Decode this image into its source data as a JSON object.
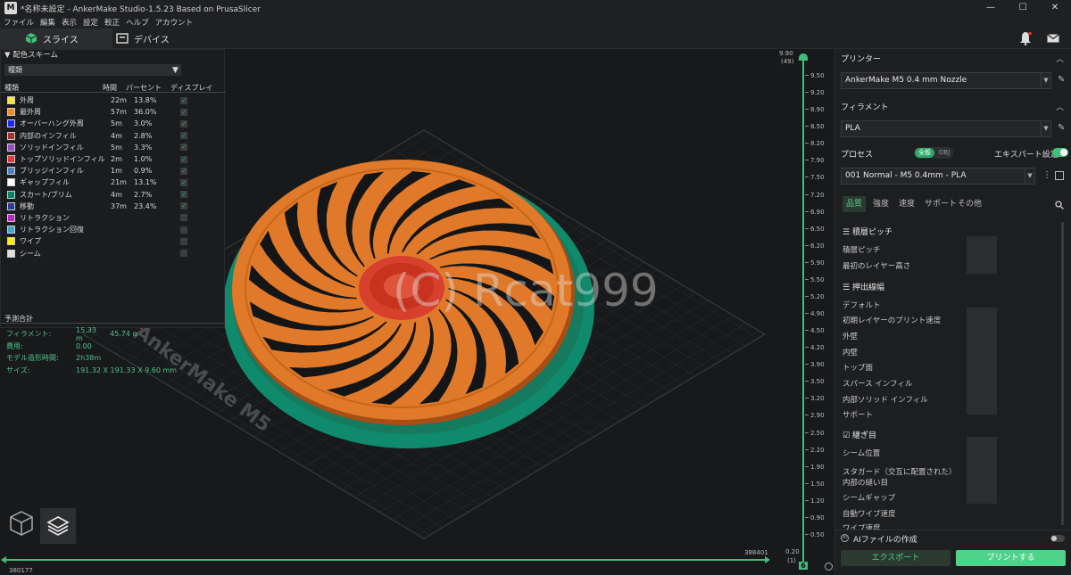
{
  "window": {
    "title": "*名称未設定 - AnkerMake Studio-1.5.23 Based on PrusaSlicer",
    "logo": "M",
    "controls": [
      "—",
      "☐",
      "✕"
    ]
  },
  "menu": [
    "ファイル",
    "編集",
    "表示",
    "設定",
    "較正",
    "ヘルプ",
    "アカウント"
  ],
  "tabs": [
    {
      "label": "スライス",
      "icon": "cube-icon"
    },
    {
      "label": "デバイス",
      "icon": "device-icon"
    }
  ],
  "legend": {
    "title": "配色スキーム",
    "scheme": "種類",
    "columns": [
      "種類",
      "時間",
      "パーセント",
      "ディスプレイ"
    ],
    "rows": [
      {
        "name": "外周",
        "time": "22m",
        "pct": "13.8%",
        "color": "#f5e642",
        "shown": true
      },
      {
        "name": "最外周",
        "time": "57m",
        "pct": "36.0%",
        "color": "#f58a1f",
        "shown": true
      },
      {
        "name": "オーバーハング外周",
        "time": "5m",
        "pct": "3.0%",
        "color": "#2424ff",
        "shown": true
      },
      {
        "name": "内部のインフィル",
        "time": "4m",
        "pct": "2.8%",
        "color": "#b0302f",
        "shown": true
      },
      {
        "name": "ソリッドインフィル",
        "time": "5m",
        "pct": "3.3%",
        "color": "#9a4fc0",
        "shown": true
      },
      {
        "name": "トップソリッドインフィル",
        "time": "2m",
        "pct": "1.0%",
        "color": "#e03a3a",
        "shown": true
      },
      {
        "name": "ブリッジインフィル",
        "time": "1m",
        "pct": "0.9%",
        "color": "#4f7fbf",
        "shown": true
      },
      {
        "name": "ギャップフィル",
        "time": "21m",
        "pct": "13.1%",
        "color": "#ffffff",
        "shown": true
      },
      {
        "name": "スカート/ブリム",
        "time": "4m",
        "pct": "2.7%",
        "color": "#00876a",
        "shown": true
      },
      {
        "name": "移動",
        "time": "37m",
        "pct": "23.4%",
        "color": "#2c3c9a",
        "shown": true
      },
      {
        "name": "リトラクション",
        "time": "",
        "pct": "",
        "color": "#c027c0",
        "shown": false
      },
      {
        "name": "リトラクション回復",
        "time": "",
        "pct": "",
        "color": "#3fa8c8",
        "shown": false
      },
      {
        "name": "ワイプ",
        "time": "",
        "pct": "",
        "color": "#ffee00",
        "shown": false
      },
      {
        "name": "シーム",
        "time": "",
        "pct": "",
        "color": "#e0e0e0",
        "shown": false
      }
    ]
  },
  "estimate": {
    "title": "予測合計",
    "filament_label": "フィラメント:",
    "filament_len": "15.33 m",
    "filament_weight": "45.74 g",
    "cost_label": "費用:",
    "cost": "0.00",
    "time_label": "モデル造形時間:",
    "time": "2h38m",
    "size_label": "サイズ:",
    "size": "191.32 X 191.33 X 9.60 mm"
  },
  "viewport": {
    "bed_label": "AnkerMake M5",
    "watermark": "(C) Rcat999",
    "hslider_left": "380177",
    "hslider_right": "388401"
  },
  "ruler": {
    "top": "9.90",
    "top_sub": "(49)",
    "bottom": "0.20",
    "bottom_sub": "(1)",
    "ticks": [
      "9.90",
      "9.50",
      "9.20",
      "8.90",
      "8.50",
      "8.20",
      "7.90",
      "7.50",
      "7.20",
      "6.90",
      "6.50",
      "6.20",
      "5.90",
      "5.50",
      "5.20",
      "4.90",
      "4.50",
      "4.20",
      "3.90",
      "3.50",
      "3.20",
      "2.90",
      "2.50",
      "2.20",
      "1.90",
      "1.50",
      "1.20",
      "0.90",
      "0.50",
      "0.20"
    ]
  },
  "panel": {
    "printer_label": "プリンター",
    "printer": "AnkerMake M5 0.4 mm Nozzle",
    "filament_label": "フィラメント",
    "filament": "PLA",
    "process_label": "プロセス",
    "mode_all": "全般",
    "mode_obj": "OBJ",
    "expert_label": "エキスパート設定",
    "process": "001 Normal - M5 0.4mm - PLA",
    "settings_tabs": [
      "品質",
      "強度",
      "速度",
      "サポート",
      "その他"
    ],
    "groups": [
      {
        "title": "積層ピッチ",
        "options": [
          "積層ピッチ",
          "最初のレイヤー高さ"
        ]
      },
      {
        "title": "押出線幅",
        "options": [
          "デフォルト",
          "初期レイヤーのプリント速度",
          "外壁",
          "内壁",
          "トップ面",
          "スパース インフィル",
          "内部ソリッド インフィル",
          "サポート"
        ]
      },
      {
        "title": "継ぎ目",
        "options": [
          "シーム位置",
          "スタガード（交互に配置された）",
          "内部の縫い目",
          "シームギャップ",
          "自動ワイプ速度",
          "ワイプ速度"
        ]
      }
    ],
    "ai_label": "AIファイルの作成",
    "export_label": "エクスポート",
    "print_label": "プリントする"
  },
  "colors": {
    "accent": "#4fd28a",
    "part": "#e07a2a",
    "brim": "#0f8a6c"
  }
}
